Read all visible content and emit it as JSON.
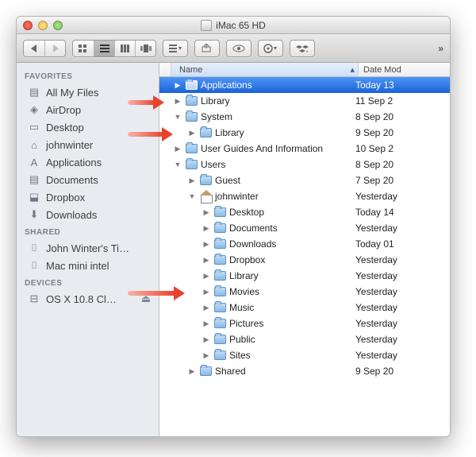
{
  "window": {
    "title": "iMac 65 HD"
  },
  "cols": {
    "name": "Name",
    "date": "Date Mod"
  },
  "sidebar": {
    "favorites_label": "FAVORITES",
    "shared_label": "SHARED",
    "devices_label": "DEVICES",
    "favorites": [
      {
        "icon": "all-my-files",
        "label": "All My Files"
      },
      {
        "icon": "airdrop",
        "label": "AirDrop"
      },
      {
        "icon": "desktop",
        "label": "Desktop"
      },
      {
        "icon": "home",
        "label": "johnwinter"
      },
      {
        "icon": "applications",
        "label": "Applications"
      },
      {
        "icon": "documents",
        "label": "Documents"
      },
      {
        "icon": "dropbox",
        "label": "Dropbox"
      },
      {
        "icon": "downloads",
        "label": "Downloads"
      }
    ],
    "shared": [
      {
        "icon": "computer",
        "label": "John Winter's Ti…"
      },
      {
        "icon": "computer",
        "label": "Mac mini intel"
      }
    ],
    "devices": [
      {
        "icon": "disk",
        "label": "OS X 10.8 Cl…",
        "eject": true
      }
    ]
  },
  "files": [
    {
      "depth": 0,
      "tri": "right",
      "icon": "app-folder",
      "name": "Applications",
      "date": "Today 13",
      "selected": true
    },
    {
      "depth": 0,
      "tri": "right",
      "icon": "folder",
      "name": "Library",
      "date": "11 Sep 2",
      "annot": true
    },
    {
      "depth": 0,
      "tri": "down",
      "icon": "folder",
      "name": "System",
      "date": "8 Sep 20"
    },
    {
      "depth": 1,
      "tri": "right",
      "icon": "folder",
      "name": "Library",
      "date": "9 Sep 20",
      "annot": true
    },
    {
      "depth": 0,
      "tri": "right",
      "icon": "folder",
      "name": "User Guides And Information",
      "date": "10 Sep 2"
    },
    {
      "depth": 0,
      "tri": "down",
      "icon": "folder",
      "name": "Users",
      "date": "8 Sep 20"
    },
    {
      "depth": 1,
      "tri": "right",
      "icon": "folder",
      "name": "Guest",
      "date": "7 Sep 20"
    },
    {
      "depth": 1,
      "tri": "down",
      "icon": "home",
      "name": "johnwinter",
      "date": "Yesterday"
    },
    {
      "depth": 2,
      "tri": "right",
      "icon": "folder",
      "name": "Desktop",
      "date": "Today 14"
    },
    {
      "depth": 2,
      "tri": "right",
      "icon": "folder",
      "name": "Documents",
      "date": "Yesterday"
    },
    {
      "depth": 2,
      "tri": "right",
      "icon": "folder",
      "name": "Downloads",
      "date": "Today 01"
    },
    {
      "depth": 2,
      "tri": "right",
      "icon": "dropbox",
      "name": "Dropbox",
      "date": "Yesterday"
    },
    {
      "depth": 2,
      "tri": "right",
      "icon": "folder",
      "name": "Library",
      "date": "Yesterday",
      "annot": true
    },
    {
      "depth": 2,
      "tri": "right",
      "icon": "folder",
      "name": "Movies",
      "date": "Yesterday"
    },
    {
      "depth": 2,
      "tri": "right",
      "icon": "folder",
      "name": "Music",
      "date": "Yesterday"
    },
    {
      "depth": 2,
      "tri": "right",
      "icon": "folder",
      "name": "Pictures",
      "date": "Yesterday"
    },
    {
      "depth": 2,
      "tri": "right",
      "icon": "folder",
      "name": "Public",
      "date": "Yesterday"
    },
    {
      "depth": 2,
      "tri": "right",
      "icon": "folder",
      "name": "Sites",
      "date": "Yesterday"
    },
    {
      "depth": 1,
      "tri": "right",
      "icon": "folder",
      "name": "Shared",
      "date": "9 Sep 20"
    }
  ],
  "icons": {
    "all-my-files": "▤",
    "airdrop": "◈",
    "desktop": "▭",
    "home": "⌂",
    "applications": "A",
    "documents": "▤",
    "dropbox": "⬓",
    "downloads": "⬇",
    "computer": "⌷",
    "disk": "⊟"
  }
}
